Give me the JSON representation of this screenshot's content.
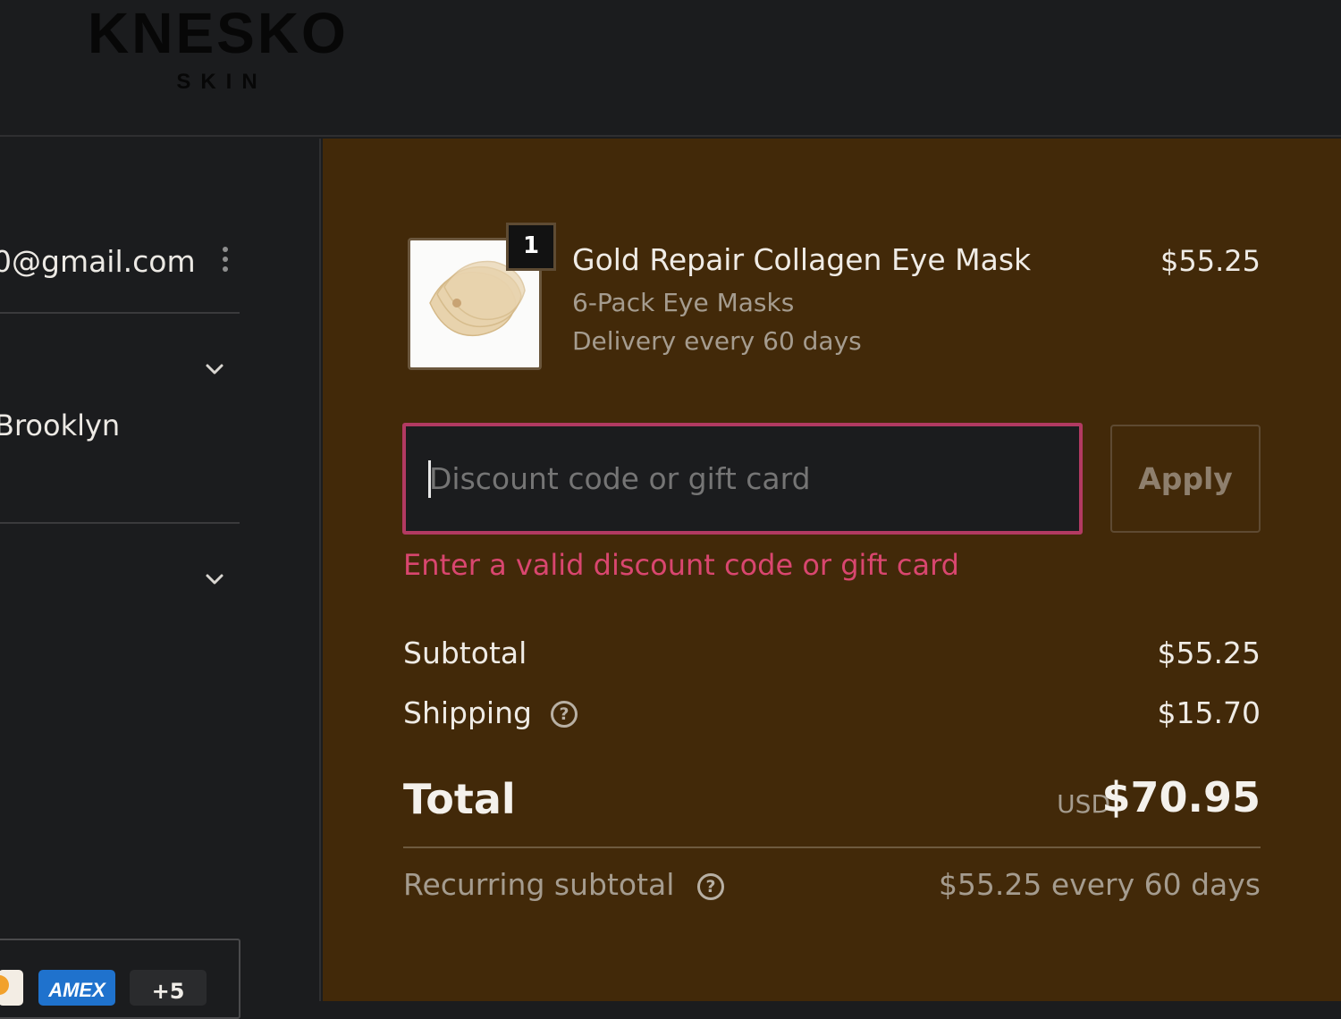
{
  "brand": {
    "name": "KNESKO",
    "tagline": "SKIN"
  },
  "contact": {
    "email": "0@gmail.com"
  },
  "shipping_address": {
    "city": "Brooklyn"
  },
  "payment": {
    "more_label": "+5",
    "card_brands": [
      "mastercard",
      "AMEX"
    ]
  },
  "cart": {
    "items": [
      {
        "quantity": "1",
        "name": "Gold Repair Collagen Eye Mask",
        "variant": "6-Pack Eye Masks",
        "delivery": "Delivery every 60 days",
        "price": "$55.25"
      }
    ]
  },
  "discount": {
    "placeholder": "Discount code or gift card",
    "value": "",
    "apply_label": "Apply",
    "error": "Enter a valid discount code or gift card"
  },
  "summary": {
    "subtotal_label": "Subtotal",
    "subtotal_value": "$55.25",
    "shipping_label": "Shipping",
    "shipping_value": "$15.70",
    "total_label": "Total",
    "currency": "USD",
    "total_value": "$70.95",
    "recurring_label": "Recurring subtotal",
    "recurring_value": "$55.25 every 60 days"
  },
  "colors": {
    "summary_background": "#422909",
    "page_background": "#1b1c1e",
    "error": "#d9466f",
    "input_error_border": "#b23a62",
    "amex_blue": "#1f72cd"
  },
  "icons": {
    "help": "question-circle-icon",
    "expand": "chevron-down-icon",
    "menu": "kebab-menu-icon"
  }
}
